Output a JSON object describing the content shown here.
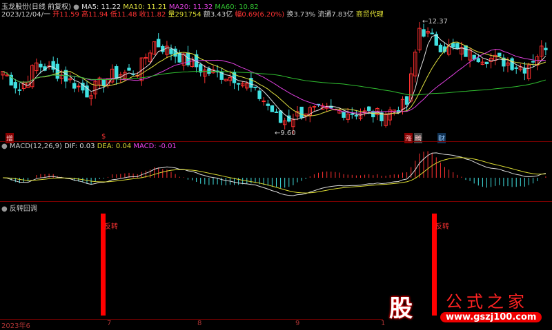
{
  "header": {
    "stock": "玉龙股份(日线 前复权)",
    "ma5": "MA5: 11.22",
    "ma10": "MA10: 11.21",
    "ma20": "MA20: 11.32",
    "ma60": "MA60: 10.82",
    "date": "2023/12/04/一",
    "open": "开11.59",
    "high": "高11.94",
    "low": "低11.48",
    "close": "收11.82",
    "vol": "量291754",
    "amount": "额3.43亿",
    "change": "幅0.69(6.20%)",
    "turnover": "换3.73%",
    "float": "流通7.83亿",
    "sector": "商贸代理"
  },
  "colors": {
    "ma5": "#e0e0e0",
    "ma10": "#e0e040",
    "ma20": "#e040e0",
    "ma60": "#30c030",
    "up": "#ff3030",
    "down": "#40e0e0"
  },
  "annotations": {
    "high": "12.37",
    "low": "9.60",
    "mark_zeng": "增",
    "mark_dollar": "$",
    "mark_zhang": "涨",
    "mark_teng": "腾",
    "mark_cai": "财"
  },
  "macd": {
    "title": "MACD(12,26,9)",
    "dif": "DIF: 0.03",
    "dea": "DEA: 0.04",
    "macd": "MACD: -0.01"
  },
  "indicator": {
    "title": "反转回调",
    "signal_label": "反转"
  },
  "xaxis": {
    "labels": [
      "2023年6",
      "7",
      "8",
      "9",
      "1"
    ]
  },
  "watermark": {
    "logo": "股",
    "name": "公式之家",
    "url": "www.gszj100.com"
  },
  "chart_data": {
    "type": "candlestick",
    "price_keypoints": [
      [
        0,
        11.1
      ],
      [
        4,
        10.6
      ],
      [
        8,
        11.3
      ],
      [
        14,
        11.0
      ],
      [
        20,
        10.5
      ],
      [
        26,
        11.0
      ],
      [
        32,
        11.1
      ],
      [
        36,
        11.9
      ],
      [
        42,
        11.5
      ],
      [
        48,
        11.1
      ],
      [
        56,
        10.9
      ],
      [
        62,
        10.3
      ],
      [
        66,
        9.7
      ],
      [
        72,
        10.0
      ],
      [
        80,
        10.0
      ],
      [
        90,
        9.9
      ],
      [
        96,
        10.2
      ],
      [
        99,
        12.3
      ],
      [
        104,
        11.8
      ],
      [
        110,
        11.6
      ],
      [
        118,
        11.4
      ],
      [
        124,
        11.2
      ],
      [
        129,
        11.82
      ]
    ],
    "ylim": [
      9.4,
      12.6
    ]
  }
}
